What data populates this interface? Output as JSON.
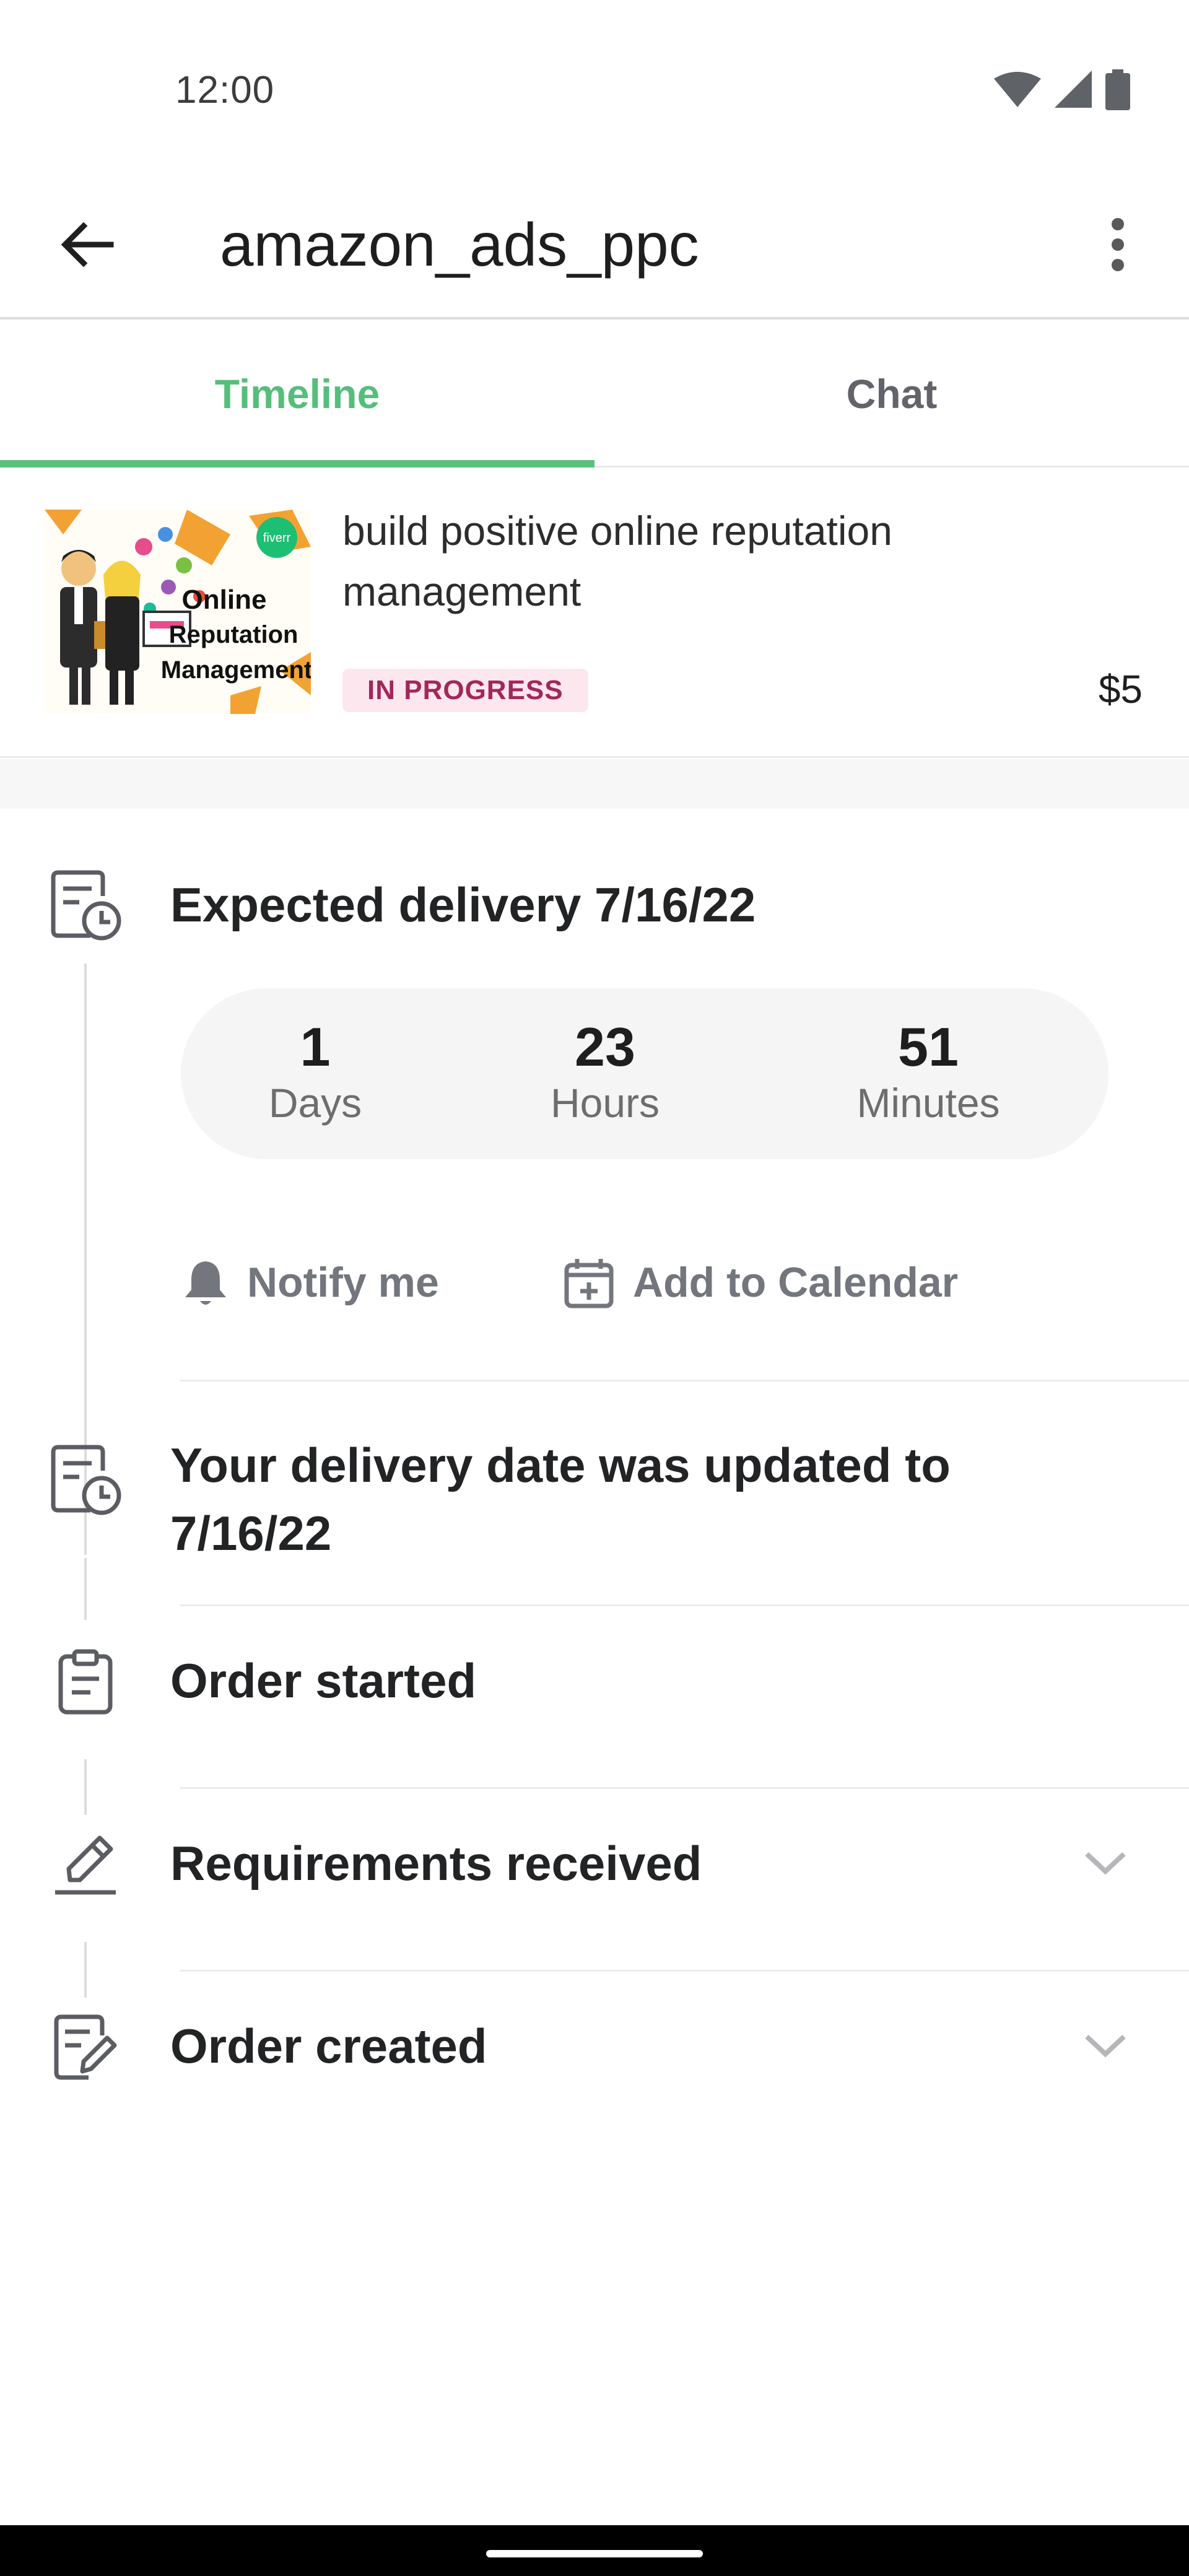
{
  "status_bar": {
    "time": "12:00",
    "icons": [
      "wifi-icon",
      "cell-signal-icon",
      "battery-icon"
    ]
  },
  "app_bar": {
    "title": "amazon_ads_ppc",
    "back_icon": "arrow-back-icon",
    "more_icon": "more-vert-icon"
  },
  "tabs": [
    {
      "label": "Timeline",
      "active": true
    },
    {
      "label": "Chat",
      "active": false
    }
  ],
  "order": {
    "title": "build positive online reputation management",
    "status": "IN PROGRESS",
    "price": "$5",
    "thumbnail": {
      "line1": "Online",
      "line2": "Reputation",
      "line3": "Management",
      "badge": "fiverr"
    }
  },
  "timeline": {
    "expected": {
      "title": "Expected delivery 7/16/22",
      "countdown": [
        {
          "value": "1",
          "label": "Days"
        },
        {
          "value": "23",
          "label": "Hours"
        },
        {
          "value": "51",
          "label": "Minutes"
        }
      ],
      "notify_label": "Notify me",
      "calendar_label": "Add to Calendar"
    },
    "events": [
      {
        "title": "Your delivery date was updated to 7/16/22",
        "icon": "calendar-clock-icon"
      },
      {
        "title": "Order started",
        "icon": "clipboard-icon"
      },
      {
        "title": "Requirements received",
        "icon": "pencil-icon",
        "expandable": true
      },
      {
        "title": "Order created",
        "icon": "edit-document-icon",
        "expandable": true
      }
    ]
  },
  "colors": {
    "accent": "#55be7b",
    "badge_bg": "#fde7ee",
    "badge_text": "#a3275a",
    "muted": "#74767e"
  }
}
